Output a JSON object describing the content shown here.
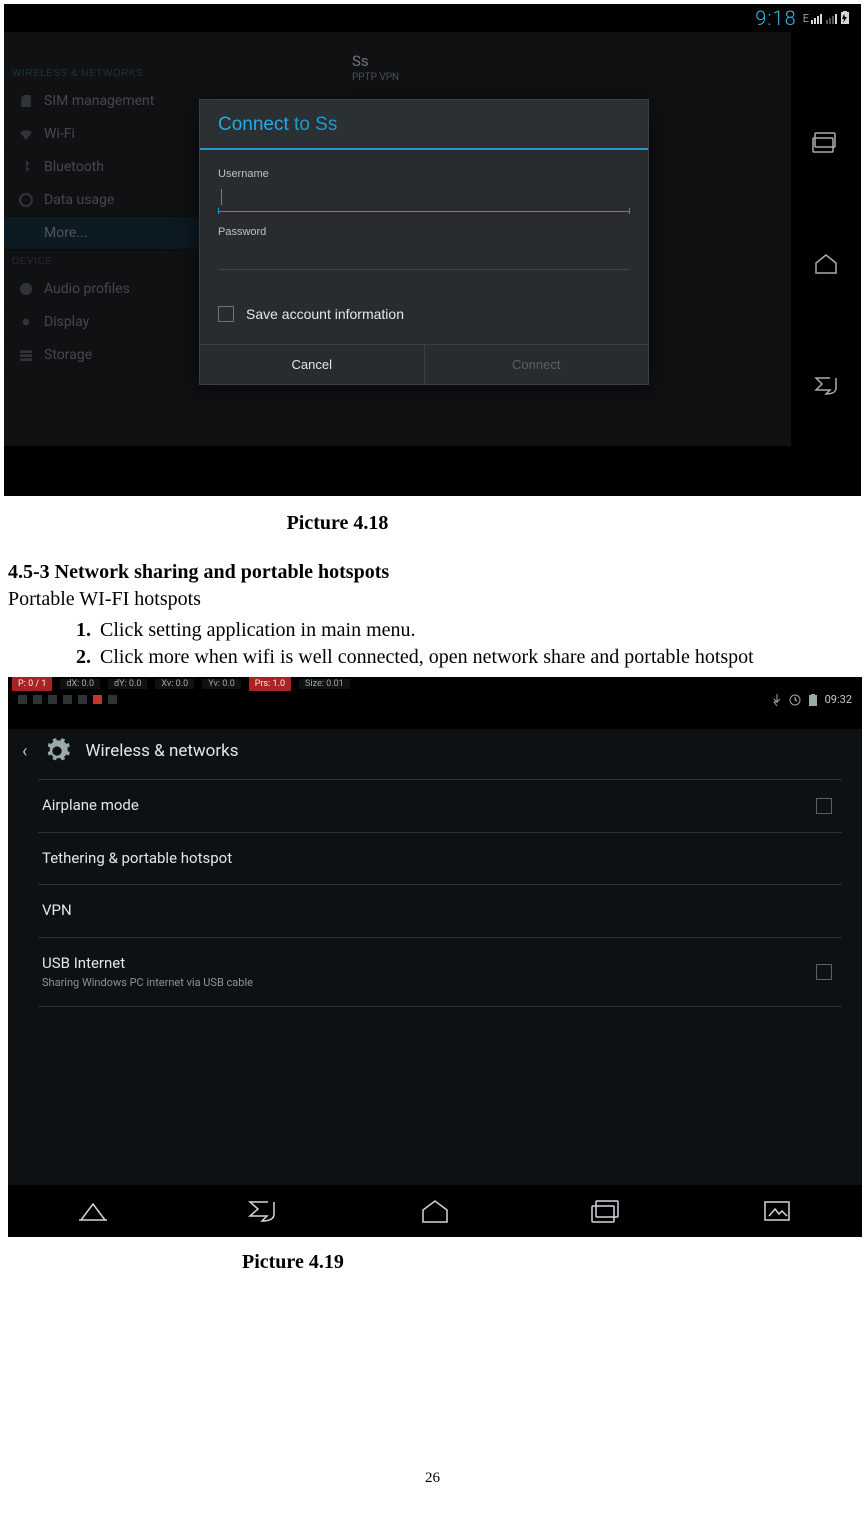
{
  "shot1": {
    "status_time": "9:18",
    "sidebar": {
      "section1": "WIRELESS & NETWORKS",
      "items1": [
        "SIM management",
        "Wi-Fi",
        "Bluetooth",
        "Data usage",
        "More..."
      ],
      "section2": "DEVICE",
      "items2": [
        "Audio profiles",
        "Display",
        "Storage"
      ]
    },
    "vpn": {
      "name": "Ss",
      "type": "PPTP VPN"
    },
    "dialog": {
      "title_prefix": "Connect",
      "title_rest": " to Ss",
      "username_lbl": "Username",
      "password_lbl": "Password",
      "save_lbl": "Save account information",
      "cancel": "Cancel",
      "connect": "Connect"
    }
  },
  "shot2": {
    "debug": {
      "p": "P: 0 / 1",
      "dx": "dX: 0.0",
      "dy": "dY: 0.0",
      "xv": "Xv: 0.0",
      "yv": "Yv: 0.0",
      "prs": "Prs: 1.0",
      "size": "Size: 0.01"
    },
    "status_time": "09:32",
    "title": "Wireless & networks",
    "items": [
      {
        "label": "Airplane mode",
        "sub": "",
        "checkbox": true
      },
      {
        "label": "Tethering & portable hotspot",
        "sub": "",
        "checkbox": false
      },
      {
        "label": "VPN",
        "sub": "",
        "checkbox": false
      },
      {
        "label": "USB Internet",
        "sub": "Sharing Windows PC internet via USB cable",
        "checkbox": true
      }
    ]
  },
  "doc": {
    "caption418": "Picture 4.18",
    "heading453": "4.5-3 Network sharing and portable hotspots",
    "portable": "Portable WI-FI hotspots",
    "step1": "Click setting application in main menu.",
    "step2": "Click more when wifi is well connected, open network share and portable hotspot",
    "caption419": "Picture 4.19",
    "pagenum": "26"
  }
}
